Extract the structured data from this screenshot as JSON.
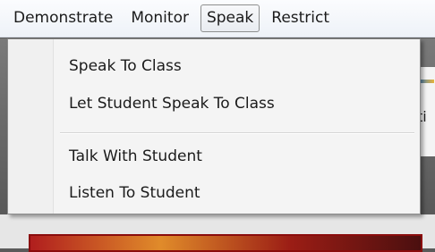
{
  "menubar": {
    "items": [
      {
        "label": "Demonstrate"
      },
      {
        "label": "Monitor"
      },
      {
        "label": "Speak"
      },
      {
        "label": "Restrict"
      }
    ]
  },
  "dropdown": {
    "items": [
      {
        "label": "Speak To Class"
      },
      {
        "label": "Let Student Speak To Class"
      },
      {
        "label": "Talk With Student"
      },
      {
        "label": "Listen To Student"
      }
    ]
  },
  "background": {
    "partial_text": "ti"
  }
}
